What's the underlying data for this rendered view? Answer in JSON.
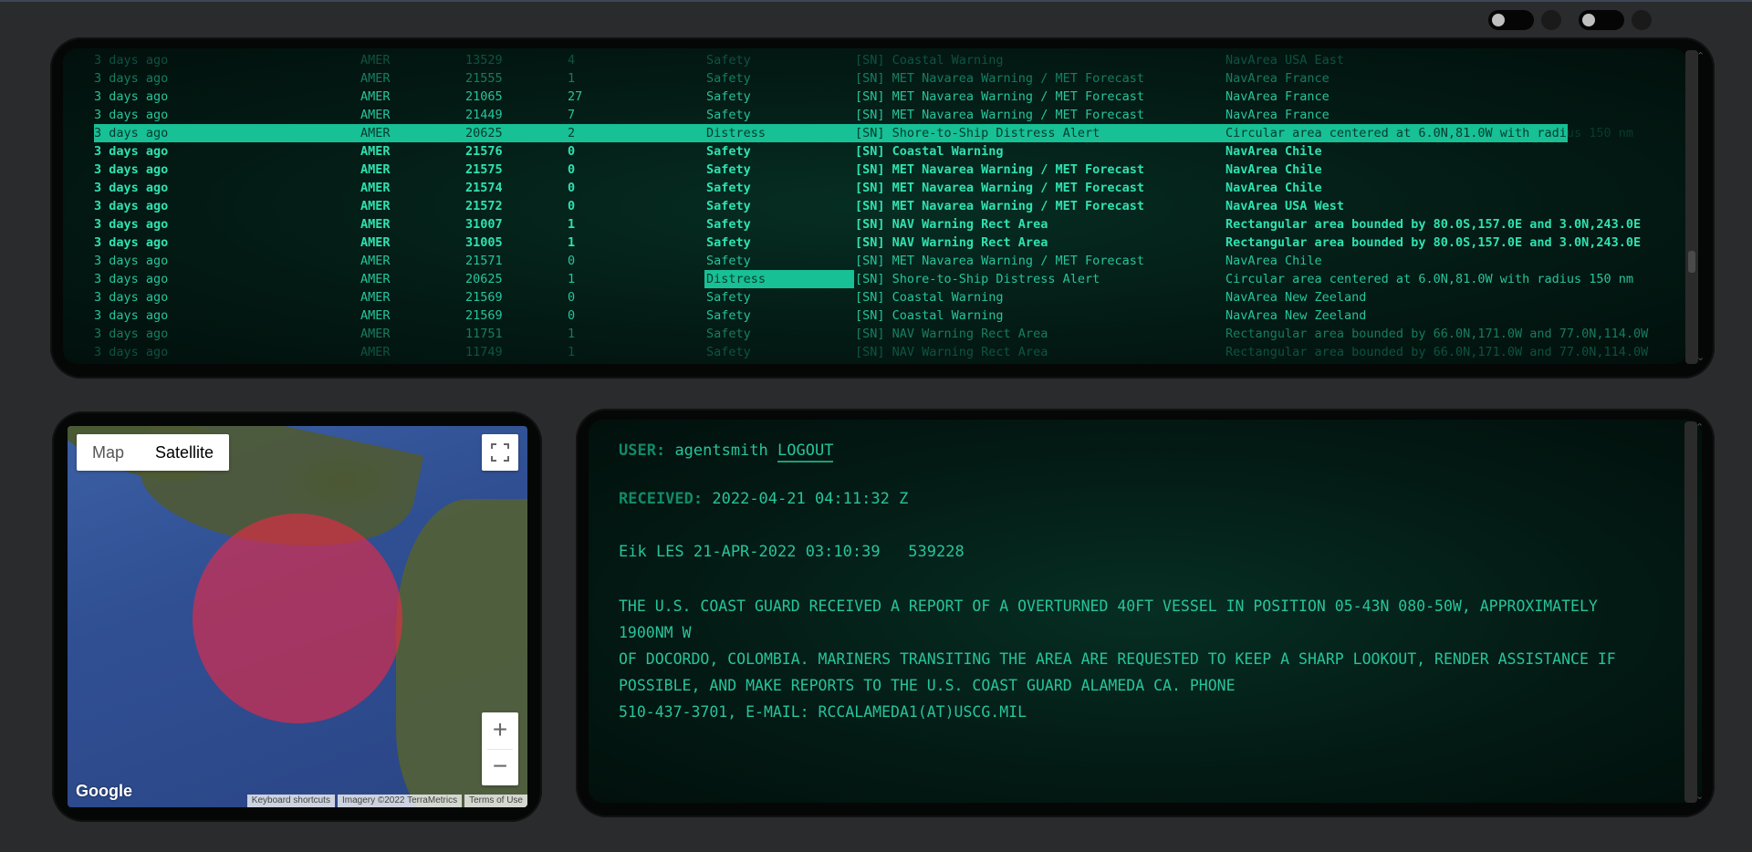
{
  "toggles": [
    {
      "name": "toggle-1"
    },
    {
      "name": "toggle-2"
    }
  ],
  "messages": {
    "columns": [
      "time",
      "region",
      "id",
      "count",
      "priority",
      "type",
      "area"
    ],
    "rows": [
      {
        "time": "3 days ago",
        "region": "AMER",
        "id": "13529",
        "count": "4",
        "priority": "Safety",
        "type": "[SN] Coastal Warning",
        "area": "NavArea USA East",
        "style": "faint"
      },
      {
        "time": "3 days ago",
        "region": "AMER",
        "id": "21555",
        "count": "1",
        "priority": "Safety",
        "type": "[SN] MET Navarea Warning / MET Forecast",
        "area": "NavArea France",
        "style": "dim"
      },
      {
        "time": "3 days ago",
        "region": "AMER",
        "id": "21065",
        "count": "27",
        "priority": "Safety",
        "type": "[SN] MET Navarea Warning / MET Forecast",
        "area": "NavArea France",
        "style": "normal"
      },
      {
        "time": "3 days ago",
        "region": "AMER",
        "id": "21449",
        "count": "7",
        "priority": "Safety",
        "type": "[SN] MET Navarea Warning / MET Forecast",
        "area": "NavArea France",
        "style": "normal"
      },
      {
        "time": "3 days ago",
        "region": "AMER",
        "id": "20625",
        "count": "2",
        "priority": "Distress",
        "type": "[SN] Shore-to-Ship Distress Alert",
        "area": "Circular area centered at 6.0N,81.0W with radius 150 nm",
        "style": "selected"
      },
      {
        "time": "3 days ago",
        "region": "AMER",
        "id": "21576",
        "count": "0",
        "priority": "Safety",
        "type": "[SN] Coastal Warning",
        "area": "NavArea Chile",
        "style": "bright"
      },
      {
        "time": "3 days ago",
        "region": "AMER",
        "id": "21575",
        "count": "0",
        "priority": "Safety",
        "type": "[SN] MET Navarea Warning / MET Forecast",
        "area": "NavArea Chile",
        "style": "bright"
      },
      {
        "time": "3 days ago",
        "region": "AMER",
        "id": "21574",
        "count": "0",
        "priority": "Safety",
        "type": "[SN] MET Navarea Warning / MET Forecast",
        "area": "NavArea Chile",
        "style": "bright"
      },
      {
        "time": "3 days ago",
        "region": "AMER",
        "id": "21572",
        "count": "0",
        "priority": "Safety",
        "type": "[SN] MET Navarea Warning / MET Forecast",
        "area": "NavArea USA West",
        "style": "bright"
      },
      {
        "time": "3 days ago",
        "region": "AMER",
        "id": "31007",
        "count": "1",
        "priority": "Safety",
        "type": "[SN] NAV Warning Rect Area",
        "area": "Rectangular area bounded by 80.0S,157.0E and 3.0N,243.0E",
        "style": "bright"
      },
      {
        "time": "3 days ago",
        "region": "AMER",
        "id": "31005",
        "count": "1",
        "priority": "Safety",
        "type": "[SN] NAV Warning Rect Area",
        "area": "Rectangular area bounded by 80.0S,157.0E and 3.0N,243.0E",
        "style": "bright"
      },
      {
        "time": "3 days ago",
        "region": "AMER",
        "id": "21571",
        "count": "0",
        "priority": "Safety",
        "type": "[SN] MET Navarea Warning / MET Forecast",
        "area": "NavArea Chile",
        "style": "normal"
      },
      {
        "time": "3 days ago",
        "region": "AMER",
        "id": "20625",
        "count": "1",
        "priority": "Distress",
        "type": "[SN] Shore-to-Ship Distress Alert",
        "area": "Circular area centered at 6.0N,81.0W with radius 150 nm",
        "style": "distress"
      },
      {
        "time": "3 days ago",
        "region": "AMER",
        "id": "21569",
        "count": "0",
        "priority": "Safety",
        "type": "[SN] Coastal Warning",
        "area": "NavArea New Zeeland",
        "style": "normal"
      },
      {
        "time": "3 days ago",
        "region": "AMER",
        "id": "21569",
        "count": "0",
        "priority": "Safety",
        "type": "[SN] Coastal Warning",
        "area": "NavArea New Zeeland",
        "style": "normal"
      },
      {
        "time": "3 days ago",
        "region": "AMER",
        "id": "11751",
        "count": "1",
        "priority": "Safety",
        "type": "[SN] NAV Warning Rect Area",
        "area": "Rectangular area bounded by 66.0N,171.0W and 77.0N,114.0W",
        "style": "dim"
      },
      {
        "time": "3 days ago",
        "region": "AMER",
        "id": "11749",
        "count": "1",
        "priority": "Safety",
        "type": "[SN] NAV Warning Rect Area",
        "area": "Rectangular area bounded by 66.0N,171.0W and 77.0N,114.0W",
        "style": "faint"
      }
    ]
  },
  "map": {
    "type_map_label": "Map",
    "type_satellite_label": "Satellite",
    "selected_type": "Satellite",
    "zoom_in": "+",
    "zoom_out": "−",
    "logo": "Google",
    "attribution": [
      "Keyboard shortcuts",
      "Imagery ©2022 TerraMetrics",
      "Terms of Use"
    ],
    "overlay_color": "#ec2846"
  },
  "detail": {
    "user_label": "USER:",
    "username": "agentsmith",
    "logout_label": "LOGOUT",
    "received_label": "RECEIVED:",
    "received_value": "2022-04-21 04:11:32 Z",
    "header_line": "Eik LES 21-APR-2022 03:10:39   539228",
    "body_lines": [
      "THE U.S. COAST GUARD RECEIVED A REPORT OF A OVERTURNED 40FT VESSEL IN POSITION 05-43N 080-50W, APPROXIMATELY 1900NM W",
      "OF DOCORDO, COLOMBIA. MARINERS TRANSITING THE AREA ARE REQUESTED TO KEEP A SHARP LOOKOUT, RENDER ASSISTANCE IF",
      "POSSIBLE, AND MAKE REPORTS TO THE U.S. COAST GUARD ALAMEDA CA. PHONE",
      "510-437-3701, E-MAIL: RCCALAMEDA1(AT)USCG.MIL"
    ]
  },
  "colors": {
    "terminal_text": "#27c49b",
    "selection": "#17c095",
    "background": "#2a2b2c"
  }
}
